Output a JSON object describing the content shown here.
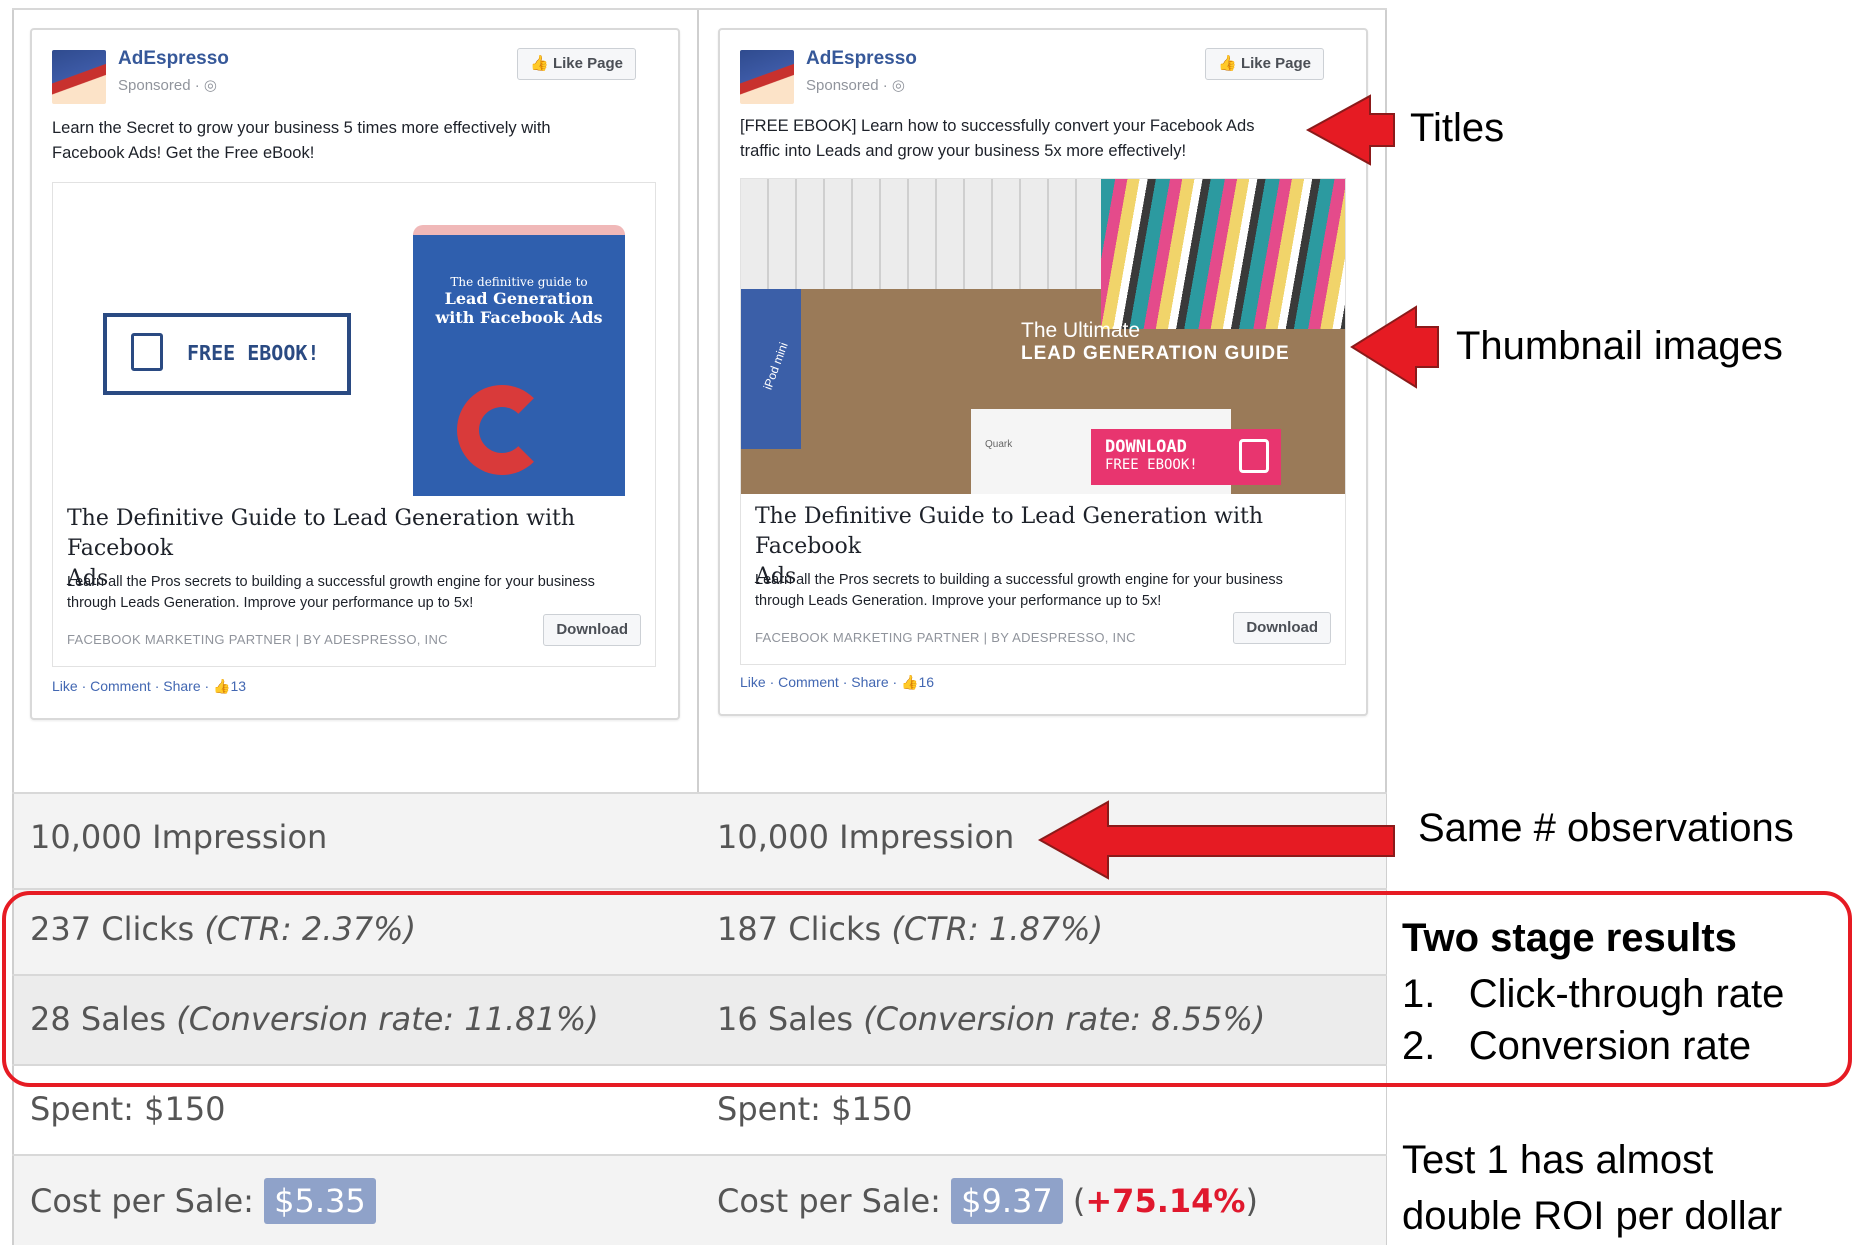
{
  "ads": [
    {
      "brand": "AdEspresso",
      "sponsored": "Sponsored · ◎",
      "like_page": "Like Page",
      "text_line1": "Learn the Secret to grow your business 5 times more effectively with",
      "text_line2": "Facebook Ads! Get the Free eBook!",
      "image_button": "FREE EBOOK!",
      "book_line1": "The definitive guide to",
      "book_line2": "Lead Generation",
      "book_line3": "with Facebook Ads",
      "link_title_line1": "The Definitive Guide to Lead Generation with Facebook",
      "link_title_line2": "Ads",
      "link_desc_line1": "Learn all the Pros secrets to building a successful growth engine for your business",
      "link_desc_line2": "through Leads Generation. Improve your performance up to 5x!",
      "caption": "FACEBOOK MARKETING PARTNER   |   BY ADESPRESSO, INC",
      "download": "Download",
      "actions": "Like · Comment · Share · 👍13"
    },
    {
      "brand": "AdEspresso",
      "sponsored": "Sponsored · ◎",
      "like_page": "Like Page",
      "text_line1": "[FREE EBOOK] Learn how to successfully convert your Facebook Ads",
      "text_line2": "traffic into Leads and grow your business 5x more effectively!",
      "image_title1": "The Ultimate",
      "image_title2": "LEAD GENERATION GUIDE",
      "image_ipod": "iPod mini",
      "image_quark": "Quark",
      "image_download1": "DOWNLOAD",
      "image_download2": "FREE EBOOK!",
      "link_title_line1": "The Definitive Guide to Lead Generation with Facebook",
      "link_title_line2": "Ads",
      "link_desc_line1": "Learn all the Pros secrets to building a successful growth engine for your business",
      "link_desc_line2": "through Leads Generation. Improve your performance up to 5x!",
      "caption": "FACEBOOK MARKETING PARTNER   |   BY ADESPRESSO, INC",
      "download": "Download",
      "actions": "Like · Comment · Share · 👍16"
    }
  ],
  "table": {
    "impressions": [
      "10,000 Impression",
      "10,000 Impression"
    ],
    "clicks": [
      {
        "count": "237 Clicks",
        "rate": "(CTR: 2.37%)"
      },
      {
        "count": "187 Clicks",
        "rate": "(CTR: 1.87%)"
      }
    ],
    "sales": [
      {
        "count": "28 Sales",
        "rate": "(Conversion rate: 11.81%)"
      },
      {
        "count": "16 Sales",
        "rate": "(Conversion rate: 8.55%)"
      }
    ],
    "spent": [
      "Spent: $150",
      "Spent: $150"
    ],
    "cost_label": "Cost per Sale:",
    "cost": [
      "$5.35",
      "$9.37"
    ],
    "cost_delta": "+75.14%"
  },
  "annotations": {
    "titles": "Titles",
    "thumbnails": "Thumbnail images",
    "observations": "Same # observations",
    "two_stage_heading": "Two stage results",
    "stage1": "Click-through rate",
    "stage2": "Conversion rate",
    "roi_line1": "Test 1 has almost",
    "roi_line2": "double ROI per dollar"
  },
  "colors": {
    "arrow_red": "#e61b23",
    "fb_blue": "#365899",
    "price_tag": "#8fa2c9",
    "delta_red": "#e0182d"
  }
}
